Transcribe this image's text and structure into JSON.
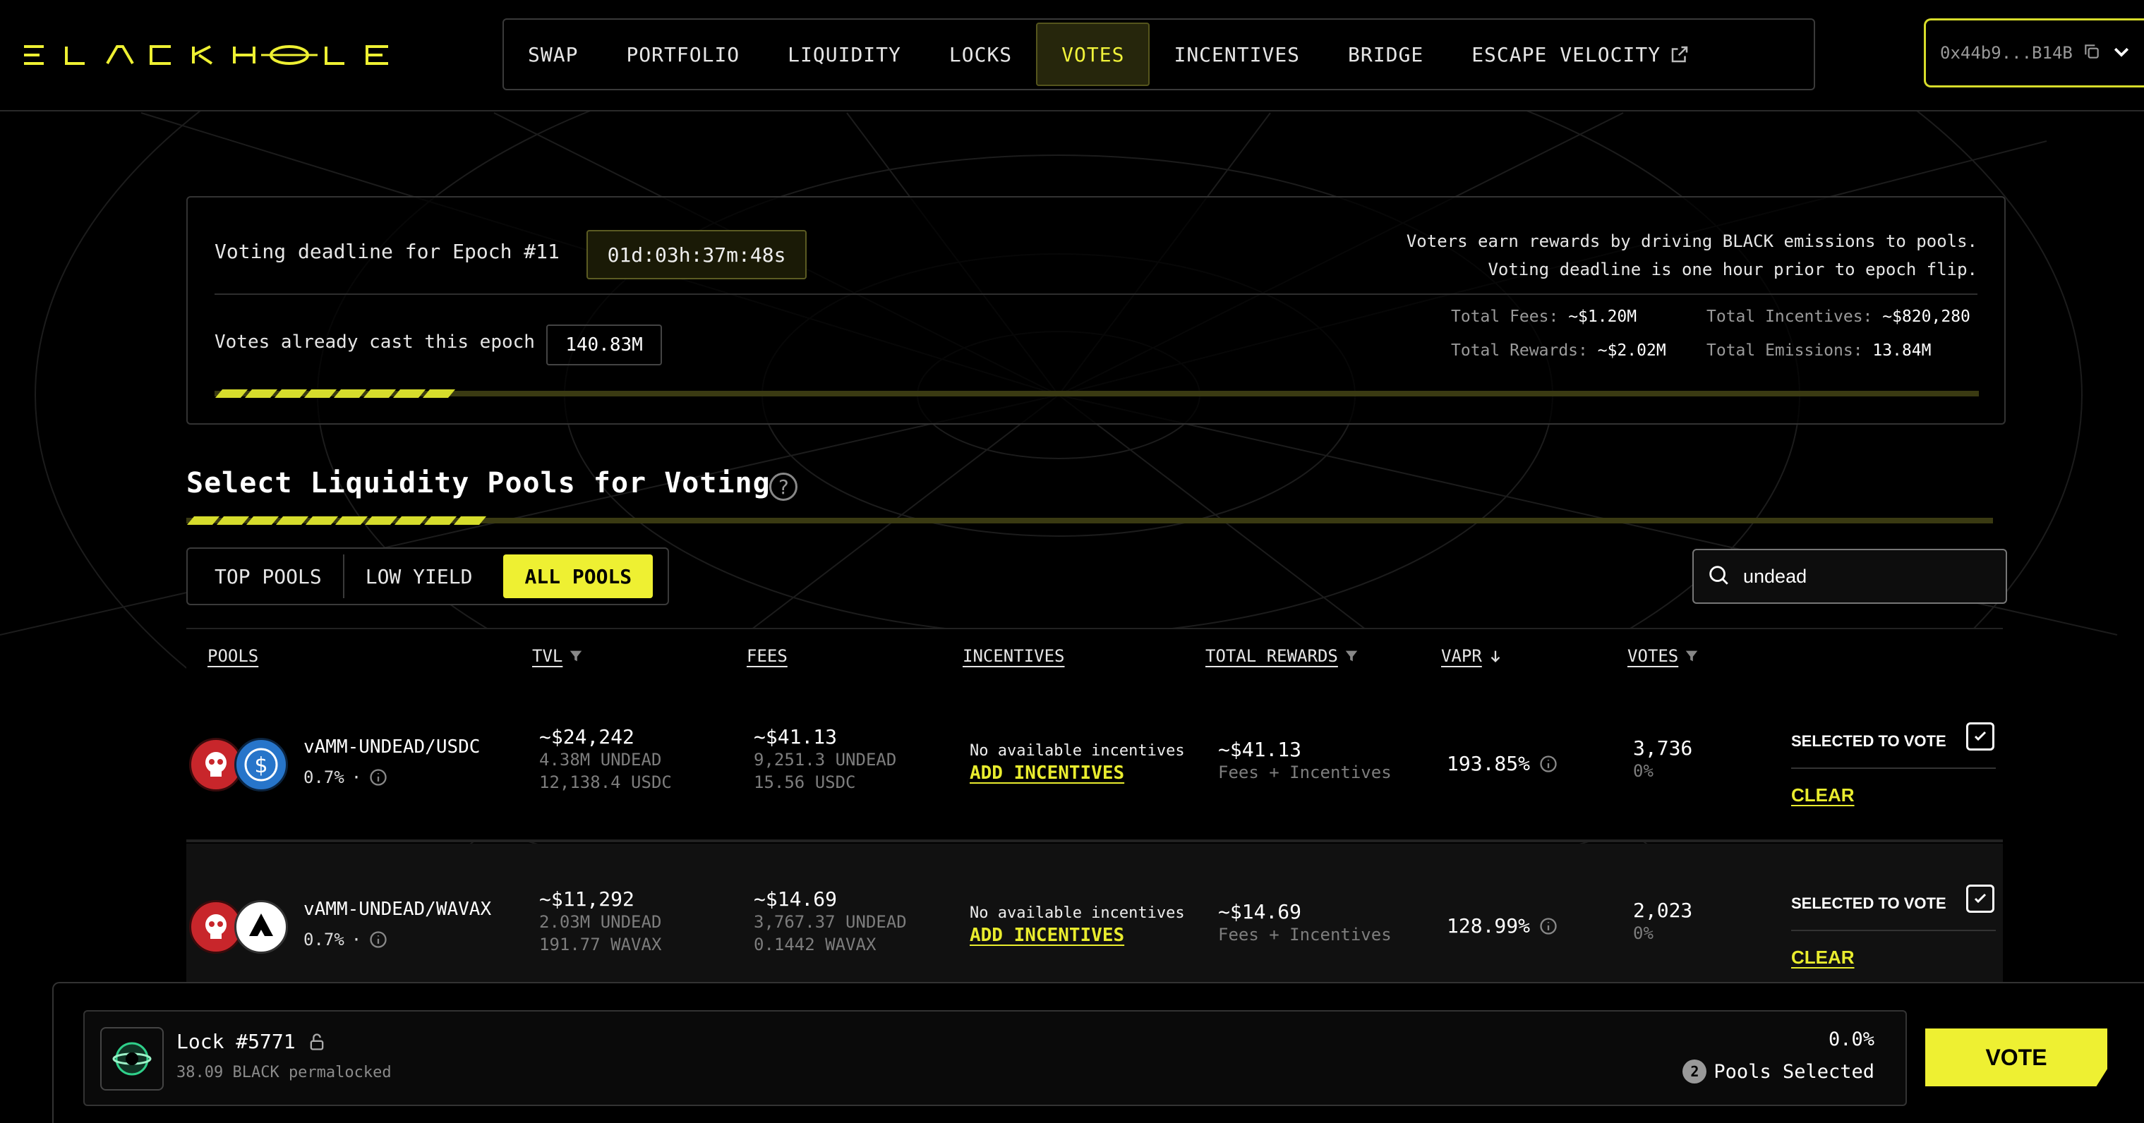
{
  "brand": {
    "logo_text": "BLACKHOLE",
    "accent": "#eef032"
  },
  "nav": {
    "items": [
      "SWAP",
      "PORTFOLIO",
      "LIQUIDITY",
      "LOCKS",
      "VOTES",
      "INCENTIVES",
      "BRIDGE",
      "ESCAPE VELOCITY"
    ],
    "active": "VOTES"
  },
  "wallet": {
    "address": "0x44b9...B14B"
  },
  "epoch": {
    "deadline_label": "Voting deadline for Epoch #11",
    "countdown": "01d:03h:37m:48s",
    "votes_cast_label": "Votes already cast this epoch",
    "votes_cast": "140.83M",
    "info_line1": "Voters earn rewards by driving BLACK emissions to pools.",
    "info_line2": "Voting deadline is one hour prior to epoch flip.",
    "total_fees_label": "Total Fees:",
    "total_fees": "~$1.20M",
    "total_incentives_label": "Total Incentives:",
    "total_incentives": "~$820,280",
    "total_rewards_label": "Total Rewards:",
    "total_rewards": "~$2.02M",
    "total_emissions_label": "Total Emissions:",
    "total_emissions": "13.84M"
  },
  "section": {
    "title": "Select Liquidity Pools for Voting",
    "help": "?"
  },
  "filters": {
    "items": [
      "TOP POOLS",
      "LOW YIELD",
      "ALL POOLS"
    ],
    "active": "ALL POOLS"
  },
  "search": {
    "value": "undead"
  },
  "table": {
    "headers": {
      "pools": "POOLS",
      "tvl": "TVL",
      "fees": "FEES",
      "incentives": "INCENTIVES",
      "total_rewards": "TOTAL REWARDS",
      "vapr": "VAPR",
      "votes": "VOTES"
    },
    "rows": [
      {
        "name": "vAMM-UNDEAD/USDC",
        "fee": "0.7%",
        "dot": "·",
        "tvl": "~$24,242",
        "tvl_a": "4.38M UNDEAD",
        "tvl_b": "12,138.4 USDC",
        "fees": "~$41.13",
        "fees_a": "9,251.3 UNDEAD",
        "fees_b": "15.56 USDC",
        "incentives": "No available incentives",
        "add_incentives": "ADD INCENTIVES",
        "rewards": "~$41.13",
        "rewards_sub": "Fees + Incentives",
        "vapr": "193.85%",
        "votes": "3,736",
        "votes_pct": "0%",
        "selected": "SELECTED TO VOTE",
        "clear": "CLEAR"
      },
      {
        "name": "vAMM-UNDEAD/WAVAX",
        "fee": "0.7%",
        "dot": "·",
        "tvl": "~$11,292",
        "tvl_a": "2.03M UNDEAD",
        "tvl_b": "191.77 WAVAX",
        "fees": "~$14.69",
        "fees_a": "3,767.37 UNDEAD",
        "fees_b": "0.1442 WAVAX",
        "incentives": "No available incentives",
        "add_incentives": "ADD INCENTIVES",
        "rewards": "~$14.69",
        "rewards_sub": "Fees + Incentives",
        "vapr": "128.99%",
        "votes": "2,023",
        "votes_pct": "0%",
        "selected": "SELECTED TO VOTE",
        "clear": "CLEAR"
      }
    ]
  },
  "lock": {
    "title": "Lock #5771",
    "subtitle": "38.09 BLACK permalocked",
    "percent": "0.0%",
    "pools_count": "2",
    "pools_selected": "Pools Selected",
    "vote_button": "VOTE"
  }
}
